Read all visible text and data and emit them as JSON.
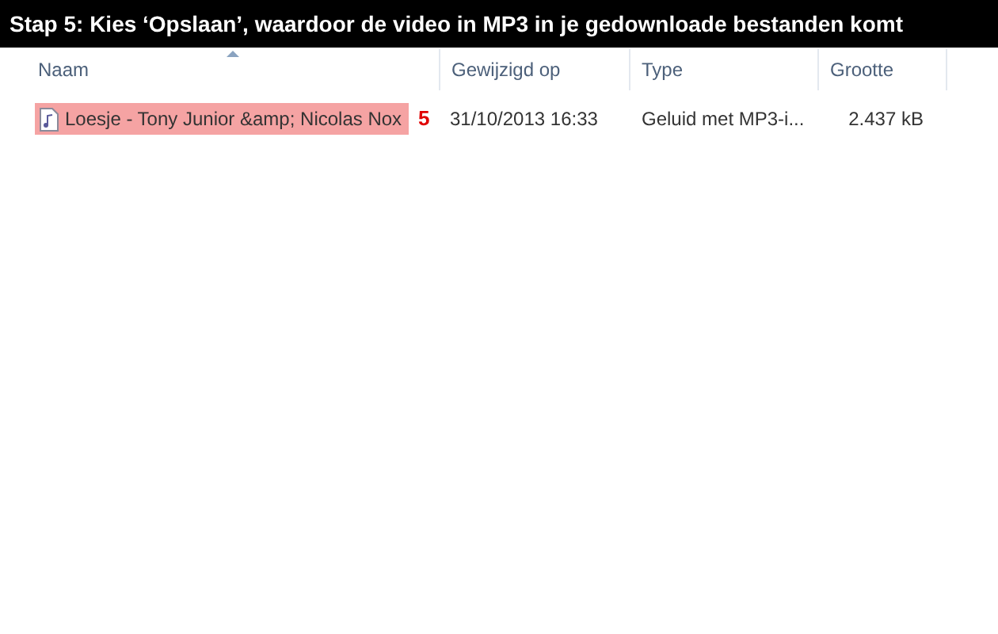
{
  "banner": {
    "title": "Stap 5: Kies ‘Opslaan’, waardoor de video in MP3 in je gedownloade bestanden komt"
  },
  "columns": [
    {
      "label": "Naam",
      "sorted": true
    },
    {
      "label": "Gewijzigd op",
      "sorted": false
    },
    {
      "label": "Type",
      "sorted": false
    },
    {
      "label": "Grootte",
      "sorted": false
    }
  ],
  "rows": [
    {
      "name": "Loesje - Tony Junior &amp; Nicolas Nox",
      "marker": "5",
      "modified": "31/10/2013 16:33",
      "type": "Geluid met MP3-i...",
      "size": "2.437 kB",
      "highlighted": true
    }
  ]
}
